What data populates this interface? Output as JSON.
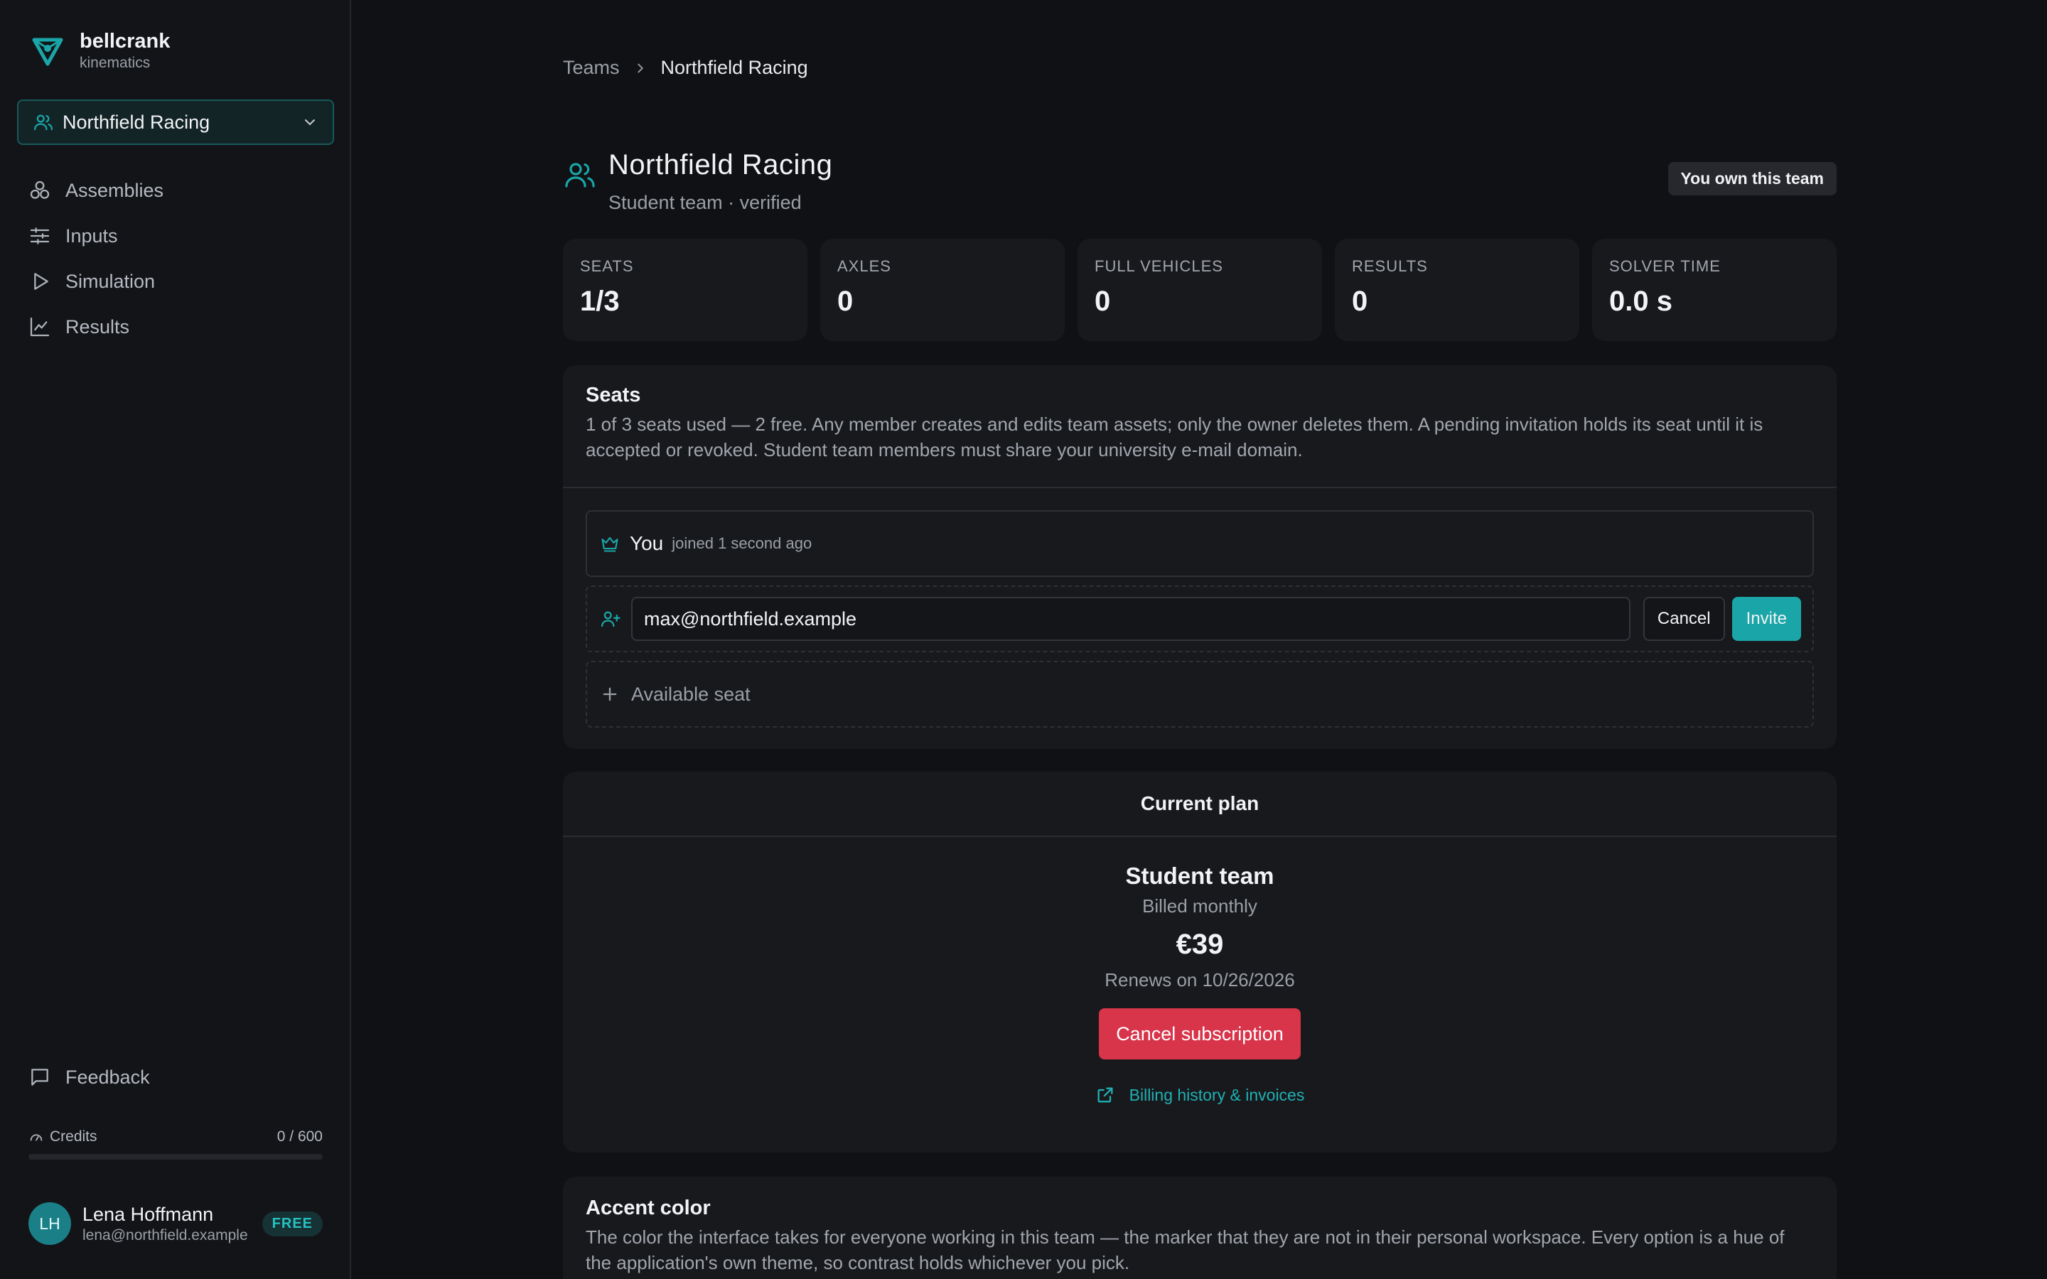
{
  "brand": {
    "name": "bellcrank",
    "subtitle": "kinematics",
    "accent_color": "#1aa6a8"
  },
  "sidebar": {
    "team_selector": {
      "label": "Northfield Racing"
    },
    "nav": [
      {
        "label": "Assemblies",
        "icon": "assemblies-icon"
      },
      {
        "label": "Inputs",
        "icon": "sliders-icon"
      },
      {
        "label": "Simulation",
        "icon": "play-icon"
      },
      {
        "label": "Results",
        "icon": "chart-icon"
      }
    ],
    "feedback": {
      "label": "Feedback"
    },
    "credits": {
      "label": "Credits",
      "value": "0 / 600",
      "used": 0,
      "total": 600
    },
    "user": {
      "initials": "LH",
      "name": "Lena Hoffmann",
      "email": "lena@northfield.example",
      "plan_badge": "FREE"
    }
  },
  "breadcrumb": {
    "parent": "Teams",
    "current": "Northfield Racing"
  },
  "team": {
    "name": "Northfield Racing",
    "subtitle": "Student team · verified",
    "owner_chip": "You own this team"
  },
  "stats": [
    {
      "label": "SEATS",
      "value": "1/3"
    },
    {
      "label": "AXLES",
      "value": "0"
    },
    {
      "label": "FULL VEHICLES",
      "value": "0"
    },
    {
      "label": "RESULTS",
      "value": "0"
    },
    {
      "label": "SOLVER TIME",
      "value": "0.0 s"
    }
  ],
  "seats": {
    "title": "Seats",
    "description": "1 of 3 seats used — 2 free. Any member creates and edits team assets; only the owner deletes them. A pending invitation holds its seat until it is accepted or revoked. Student team members must share your university e-mail domain.",
    "owner": {
      "name": "You",
      "joined": "joined 1 second ago"
    },
    "invite": {
      "value": "max@northfield.example",
      "cancel_label": "Cancel",
      "invite_label": "Invite"
    },
    "available_label": "Available seat"
  },
  "plan": {
    "header": "Current plan",
    "name": "Student team",
    "billing": "Billed monthly",
    "price": "€39",
    "renews": "Renews on 10/26/2026",
    "cancel_label": "Cancel subscription",
    "billing_link": "Billing history & invoices"
  },
  "accent": {
    "title": "Accent color",
    "description": "The color the interface takes for everyone working in this team — the marker that they are not in their personal workspace. Every option is a hue of the application's own theme, so contrast holds whichever you pick."
  },
  "colors": {
    "danger": "#d8344a",
    "accent": "#1aa6a8",
    "background": "#101114",
    "card": "#18191d"
  }
}
